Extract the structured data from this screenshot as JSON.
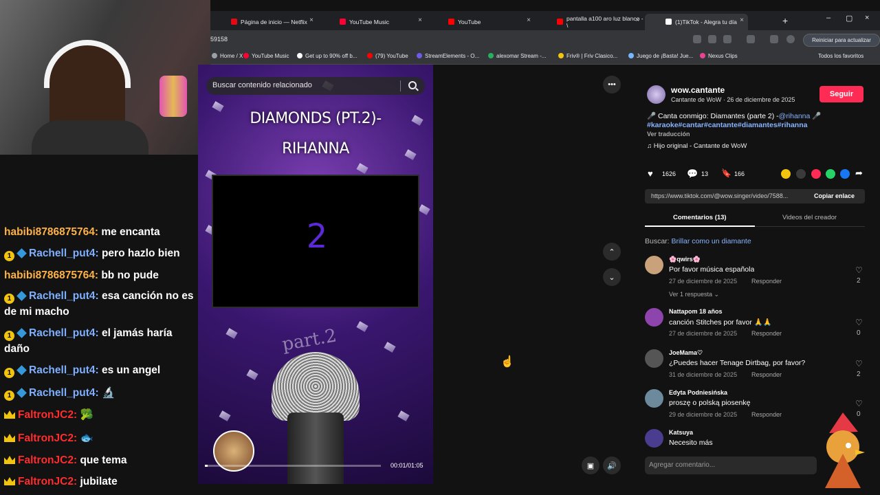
{
  "browser": {
    "tabs": [
      {
        "title": "Página de inicio — Netflix",
        "favicon_color": "#e50914"
      },
      {
        "title": "YouTube Music",
        "favicon_color": "#ff0033"
      },
      {
        "title": "YouTube",
        "favicon_color": "#ff0000"
      },
      {
        "title": "pantalla a100 aro luz blanco - \\",
        "favicon_color": "#ff0000"
      },
      {
        "title": "(1)TikTok - Alegra tu día",
        "favicon_color": "#ffffff"
      }
    ],
    "new_tab_label": "+",
    "close_label": "×",
    "address_fragment": "59158",
    "update_button": "Reiniciar para actualizar",
    "bookmarks": [
      {
        "label": "Home / X",
        "color": "#9aa0a6"
      },
      {
        "label": "YouTube Music",
        "color": "#ff0033"
      },
      {
        "label": "Get up to 90% off b...",
        "color": "#ffffff"
      },
      {
        "label": "(79) YouTube",
        "color": "#ff0000"
      },
      {
        "label": "StreamElements - O...",
        "color": "#6c5ce7"
      },
      {
        "label": "alexomar Stream -...",
        "color": "#27ae60"
      },
      {
        "label": "Friv® | Friv Clasico...",
        "color": "#f1c40f"
      },
      {
        "label": "Juego de ¡Basta! Jue...",
        "color": "#74b9ff"
      },
      {
        "label": "Nexus Clips",
        "color": "#e84393"
      }
    ],
    "all_bookmarks": "Todos los favoritos"
  },
  "video": {
    "title_line1": "DIAMONDS (PT.2)-",
    "title_line2": "RIHANNA",
    "countdown": "2",
    "overlay_text": "part.2",
    "search_placeholder": "Buscar contenido relacionado",
    "time": "00:01/01:05",
    "progress": 0.015
  },
  "creator": {
    "handle": "wow.cantante",
    "subtitle": "Cantante de WoW · 26 de diciembre de 2025",
    "follow": "Seguir",
    "caption": "🎤 Canta conmigo: Diamantes (parte 2) -",
    "mention": "@rihanna",
    "caption_tail": " 🎤",
    "hashtags": "#karaoke#cantar#cantante#diamantes#rihanna",
    "see_translation": "Ver traducción",
    "sound": "Hijo original - Cantante de WoW",
    "likes": "1626",
    "comments": "13",
    "saves": "166",
    "link": "https://www.tiktok.com/@wow.singer/video/7588...",
    "copy_link": "Copiar enlace",
    "tab_comments": "Comentarios (13)",
    "tab_videos": "Videos del creador",
    "search_prefix": "Buscar:",
    "search_term": "Brillar como un diamante",
    "add_comment": "Agregar comentario..."
  },
  "comments": [
    {
      "user": "🌸qwirs🌸",
      "text": "Por favor música española",
      "date": "27 de diciembre de 2025",
      "reply": "Responder",
      "likes": "2",
      "replies": "Ver 1 respuesta",
      "avatar_color": "#c9a27c"
    },
    {
      "user": "Nattapom 18 años",
      "text": "canción Stitches por favor 🙏🙏",
      "date": "27 de diciembre de 2025",
      "reply": "Responder",
      "likes": "0",
      "avatar_color": "#8e44ad"
    },
    {
      "user": "JoeMama♡",
      "text": "¿Puedes hacer Tenage Dirtbag, por favor?",
      "date": "31 de diciembre de 2025",
      "reply": "Responder",
      "likes": "2",
      "avatar_color": "#555555"
    },
    {
      "user": "Edyta Podniesińska",
      "text": "proszę o polską piosenkę",
      "date": "29 de diciembre de 2025",
      "reply": "Responder",
      "likes": "0",
      "avatar_color": "#6d8a9c"
    },
    {
      "user": "Katsuya",
      "text": "Necesito más",
      "avatar_color": "#4a3d8f"
    }
  ],
  "chat": [
    {
      "badges": [],
      "user": "habibi8786875764:",
      "user_color": "#ffb347",
      "msg": "me encanta"
    },
    {
      "badges": [
        "coin",
        "cube"
      ],
      "user": "Rachell_put4:",
      "user_color": "#7fb0ff",
      "msg": "pero hazlo bien"
    },
    {
      "badges": [],
      "user": "habibi8786875764:",
      "user_color": "#ffb347",
      "msg": "bb no pude"
    },
    {
      "badges": [
        "coin",
        "cube"
      ],
      "user": "Rachell_put4:",
      "user_color": "#7fb0ff",
      "msg": "esa canción no es de mi macho"
    },
    {
      "badges": [
        "coin",
        "cube"
      ],
      "user": "Rachell_put4:",
      "user_color": "#7fb0ff",
      "msg": "el jamás haría daño"
    },
    {
      "badges": [
        "coin",
        "cube"
      ],
      "user": "Rachell_put4:",
      "user_color": "#7fb0ff",
      "msg": "es un angel"
    },
    {
      "badges": [
        "coin",
        "cube"
      ],
      "user": "Rachell_put4:",
      "user_color": "#7fb0ff",
      "msg": "🔬"
    },
    {
      "badges": [
        "crown"
      ],
      "user": "FaltronJC2:",
      "user_color": "#ff2d2d",
      "msg": "🥦"
    },
    {
      "badges": [
        "crown"
      ],
      "user": "FaltronJC2:",
      "user_color": "#ff2d2d",
      "msg": "🐟"
    },
    {
      "badges": [
        "crown"
      ],
      "user": "FaltronJC2:",
      "user_color": "#ff2d2d",
      "msg": "que tema"
    },
    {
      "badges": [
        "crown"
      ],
      "user": "FaltronJC2:",
      "user_color": "#ff2d2d",
      "msg": "jubilate"
    }
  ],
  "icons": [
    "search-icon",
    "more-icon",
    "chevron-up-icon",
    "chevron-down-icon",
    "volume-icon",
    "pip-icon",
    "heart-icon",
    "comment-icon",
    "bookmark-icon",
    "share-icon",
    "music-note-icon",
    "mouse-cursor-icon"
  ]
}
